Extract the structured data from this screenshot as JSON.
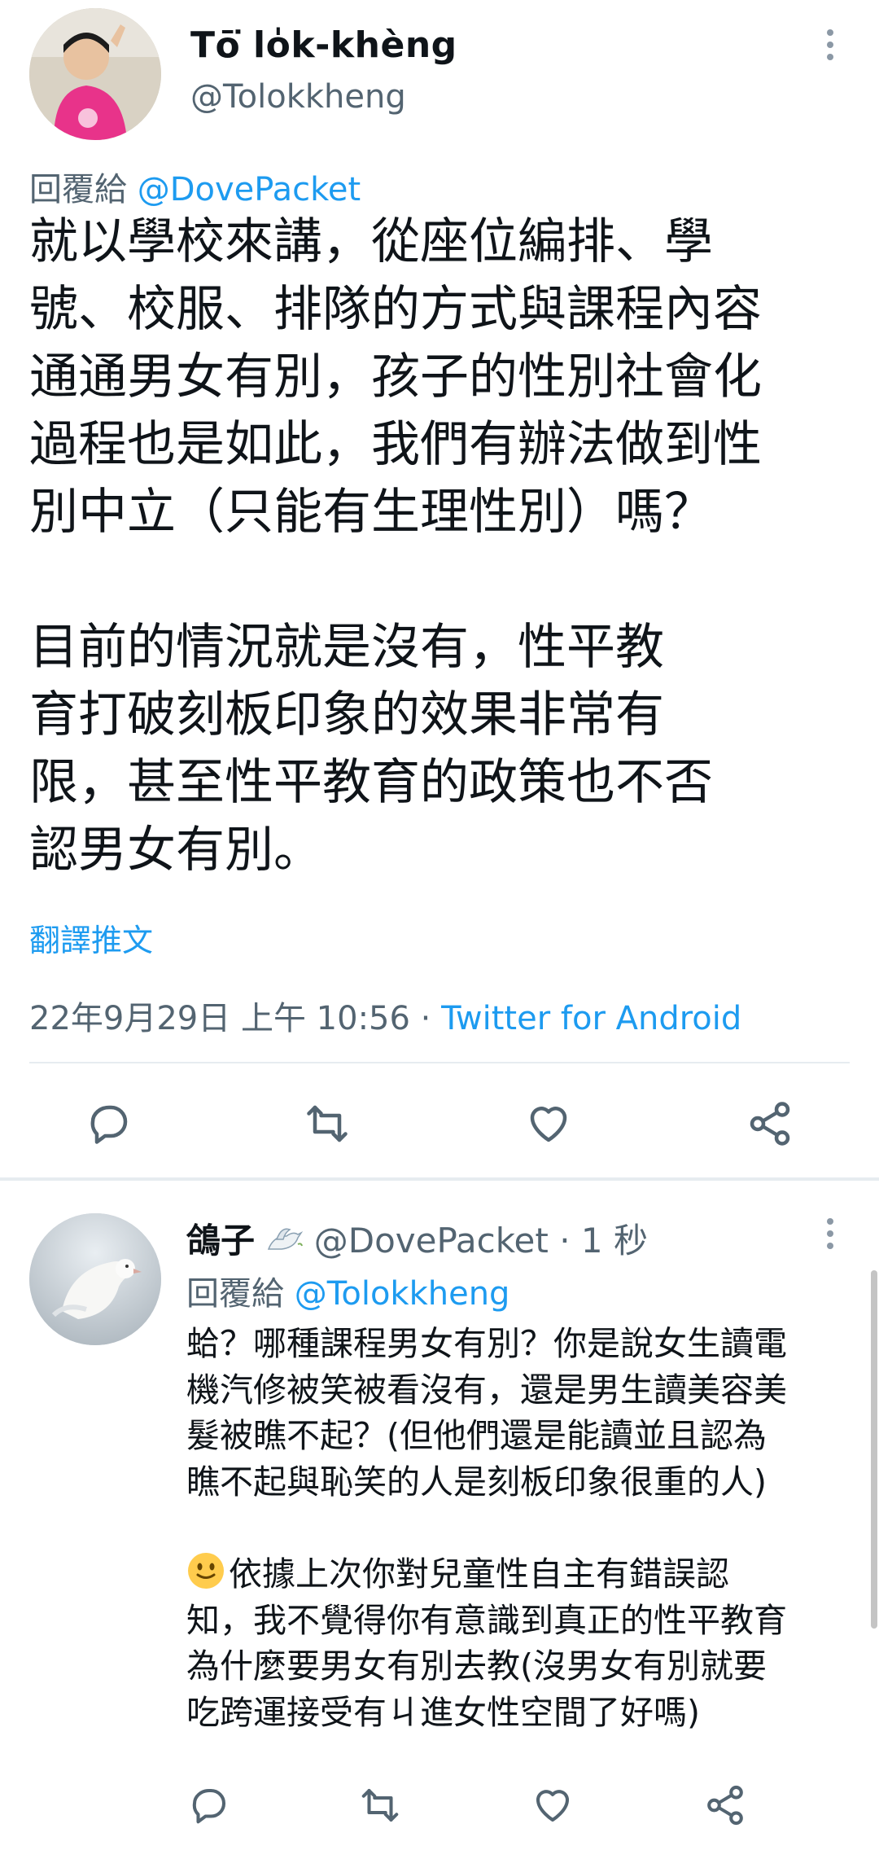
{
  "main_tweet": {
    "display_name": "Tō͘ lo̍k-khèng",
    "handle": "@Tolokkheng",
    "reply_prefix": "回覆給",
    "reply_to": "@DovePacket",
    "body": "就以學校來講，從座位編排、學\n號、校服、排隊的方式與課程內容\n通通男女有別，孩子的性別社會化\n過程也是如此，我們有辦法做到性\n別中立（只能有生理性別）嗎？\n\n目前的情況就是沒有，性平教\n育打破刻板印象的效果非常有\n限，甚至性平教育的政策也不否\n認男女有別。",
    "translate_label": "翻譯推文",
    "timestamp": "22年9月29日 上午 10:56",
    "separator": " · ",
    "source": "Twitter for Android"
  },
  "reply_tweet": {
    "display_name": "鴿子",
    "name_emoji": "dove-emoji",
    "handle": "@DovePacket",
    "time": "· 1 秒",
    "reply_prefix": "回覆給",
    "reply_to": "@Tolokkheng",
    "body_para1": "蛤？哪種課程男女有別？你是說女生讀電\n機汽修被笑被看沒有，還是男生讀美容美\n髮被瞧不起？(但他們還是能讀並且認為\n瞧不起與恥笑的人是刻板印象很重的人)",
    "body_para2": "依據上次你對兒童性自主有錯誤認\n知，我不覺得你有意識到真正的性平教育\n為什麼要男女有別去教(沒男女有別就要\n吃跨運接受有ㄐ進女性空間了好嗎)"
  },
  "icons": {
    "more": "more-vertical-icon",
    "reply": "reply-icon",
    "retweet": "retweet-icon",
    "like": "heart-icon",
    "share": "share-icon",
    "emoji": "slightly-smiling-face-emoji"
  },
  "colors": {
    "link": "#1d9bf0",
    "text": "#0f1419",
    "muted": "#536471",
    "divider": "#e6ecf0"
  }
}
